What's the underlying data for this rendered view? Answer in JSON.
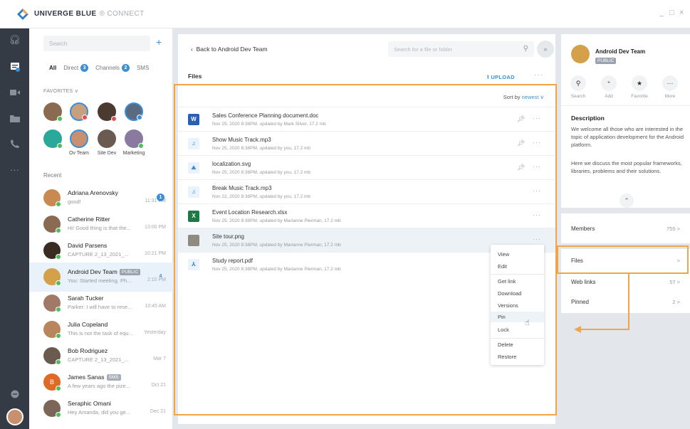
{
  "app": {
    "brand": "UNIVERGE BLUE",
    "brand_sub": "® CONNECT",
    "win_min": "_",
    "win_max": "□",
    "win_close": "×"
  },
  "rail": {
    "icons": [
      "headset-icon",
      "chat-icon",
      "video-icon",
      "folder-icon",
      "phone-icon",
      "more-icon"
    ]
  },
  "contacts": {
    "search_placeholder": "Search",
    "add": "+",
    "tabs": [
      {
        "label": "All",
        "badge": ""
      },
      {
        "label": "Direct",
        "badge": "3"
      },
      {
        "label": "Channels",
        "badge": "2"
      },
      {
        "label": "SMS",
        "badge": ""
      }
    ],
    "favorites_label": "FAVORITES ∨",
    "fav_captions": [
      "Ov Team",
      "Site Dev",
      "Marketing"
    ],
    "recent_label": "Recent",
    "recent": [
      {
        "name": "Adriana Arenovsky",
        "preview": "good!",
        "time": "11:31 PM",
        "badge": "1",
        "color": "#c98a52"
      },
      {
        "name": "Catherine Ritter",
        "preview": "Hi! Good thing is that the...",
        "time": "13:00 PM",
        "badge": "",
        "color": "#8a6b52"
      },
      {
        "name": "David Parsens",
        "preview": "CAPTURE 2_13_2021_...",
        "time": "10:21 PM",
        "badge": "",
        "color": "#3b2c22"
      },
      {
        "name": "Android Dev Team",
        "preview": "You: Started meeting, Ph...",
        "time": "2:10 PM",
        "badge": "4",
        "color": "#d4a04a",
        "tag": "PUBLIC"
      },
      {
        "name": "Sarah Tucker",
        "preview": "Parker: I will have to rese...",
        "time": "10:45 AM",
        "badge": "",
        "color": "#a07a66"
      },
      {
        "name": "Julia Copeland",
        "preview": "This is not the task of equ...",
        "time": "Yesterday",
        "badge": "",
        "color": "#b8855c"
      },
      {
        "name": "Bob Rodriguez",
        "preview": "CAPTURE 2_13_2021_...",
        "time": "Mar 7",
        "badge": "",
        "color": "#6b5a4e"
      },
      {
        "name": "James Sanas",
        "preview": "A few years ago the pize...",
        "time": "Oct 21",
        "badge": "",
        "color": "#e06a25",
        "tag": "SMS",
        "initial": "B"
      },
      {
        "name": "Seraphic Omani",
        "preview": "Hey Amanda, did you ge...",
        "time": "Dec 21",
        "badge": "",
        "color": "#7c6658"
      }
    ]
  },
  "files_panel": {
    "back_label": "Back to Android Dev Team",
    "search_placeholder": "Search for a file or folder",
    "collapse": "»",
    "title": "Files",
    "upload_label": "UPLOAD",
    "sort_label": "Sort by",
    "sort_value": "newest",
    "files": [
      {
        "name": "Sales Conference Planning document.doc",
        "meta": "Nov 25, 2020 8:38PM, updated by Mark Silver, 17.2 mb",
        "type": "word",
        "icon": "W",
        "pinned": true
      },
      {
        "name": "Show Music Track.mp3",
        "meta": "Nov 25, 2020 8:38PM, updated by you, 17.2 mb",
        "type": "audio",
        "icon": "♫",
        "pinned": true
      },
      {
        "name": "localization.svg",
        "meta": "Nov 25, 2020 8:38PM, updated by you, 17.2 mb",
        "type": "image",
        "icon": "⛰",
        "pinned": true
      },
      {
        "name": "Break Music Track.mp3",
        "meta": "Nov 22, 2020 8:38PM, updated by you, 17.2 mb",
        "type": "audio",
        "icon": "♫",
        "pinned": false
      },
      {
        "name": "Event Location Research.xlsx",
        "meta": "Nov 25, 2020 8:38PM, updated by Marianne Pierman, 17.2 mb",
        "type": "excel",
        "icon": "X",
        "pinned": false
      },
      {
        "name": "Site tour.png",
        "meta": "Nov 25, 2020 8:38PM, updated by Marianne Pierman, 17.2 mb",
        "type": "photo",
        "icon": "",
        "pinned": false
      },
      {
        "name": "Study report.pdf",
        "meta": "Nov 25, 2020 8:38PM, updated by Marianne Pierman, 17.2 mb",
        "type": "pdf",
        "icon": "⅄",
        "pinned": false
      }
    ],
    "context_menu": [
      "View",
      "Edit",
      "Get link",
      "Download",
      "Versions",
      "Pin",
      "Lock",
      "Delete",
      "Restore"
    ]
  },
  "right_panel": {
    "group_name": "Android Dev Team",
    "group_tag": "PUBLIC",
    "actions": [
      {
        "icon": "search-icon",
        "glyph": "⚲",
        "label": "Search"
      },
      {
        "icon": "add-user-icon",
        "glyph": "⁺",
        "label": "Add"
      },
      {
        "icon": "star-icon",
        "glyph": "★",
        "label": "Favorite"
      },
      {
        "icon": "more-icon",
        "glyph": "···",
        "label": "More"
      }
    ],
    "description_title": "Description",
    "description_1": "We welcome all those who are interested in the topic of application development for the Android platform.",
    "description_2": "Here we discuss the most popular frameworks, libraries, problems and their solutions.",
    "expand": "⌃",
    "sections": [
      {
        "label": "Members",
        "count": "755  >"
      },
      {
        "label": "Files",
        "count": ">"
      },
      {
        "label": "Web links",
        "count": "57  >"
      },
      {
        "label": "Pinned",
        "count": "2  >"
      }
    ]
  },
  "colors": {
    "accent": "#3c8fd6",
    "highlight": "#f0a54a",
    "rail": "#353b44"
  }
}
